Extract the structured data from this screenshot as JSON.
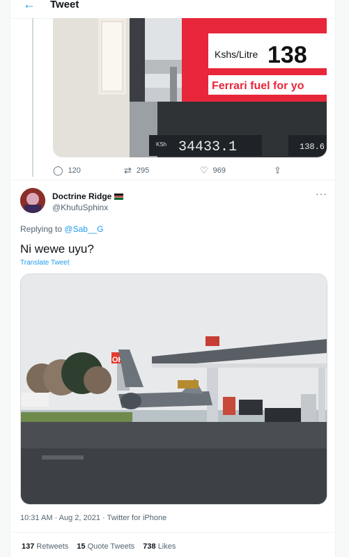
{
  "header": {
    "title": "Tweet",
    "back_icon": "arrow-left-icon"
  },
  "quoted_tweet": {
    "photo": {
      "sign_unit": "Kshs/Litre",
      "sign_price": "138",
      "sign_banner": "Ferrari fuel for yo",
      "pump_label": "KSh",
      "pump_amount": "34433.1",
      "pump_price": "138.6"
    },
    "actions": {
      "replies": "120",
      "retweets": "295",
      "likes": "969"
    }
  },
  "tweet": {
    "name": "Doctrine Ridge",
    "handle": "@KhufuSphinx",
    "replying_prefix": "Replying to",
    "replying_to": "@Sab__G",
    "text": "Ni wewe uyu?",
    "translate_label": "Translate Tweet",
    "photo": {
      "station_sign": "OK"
    },
    "time": "10:31 AM",
    "date": "Aug 2, 2021",
    "source": "Twitter for iPhone",
    "separator": "·",
    "more_label": "···"
  },
  "stats": [
    {
      "count": "137",
      "label": "Retweets"
    },
    {
      "count": "15",
      "label": "Quote Tweets"
    },
    {
      "count": "738",
      "label": "Likes"
    }
  ],
  "colors": {
    "accent": "#1d9bf0",
    "secondary_text": "#536471",
    "primary_text": "#0f1419",
    "sign_red": "#e8273a"
  }
}
